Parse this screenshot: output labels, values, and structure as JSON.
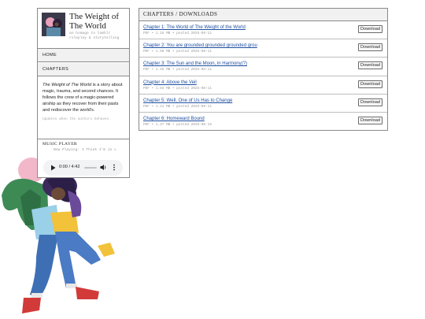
{
  "site": {
    "title": "The Weight of The World",
    "tagline": "an homage to tumblr roleplay & storytelling"
  },
  "nav": {
    "items": [
      {
        "label": "HOME"
      },
      {
        "label": "CHAPTERS"
      }
    ]
  },
  "about": {
    "title_italic": "The Weight of The World",
    "text_rest": " is a story about magic, trauma, and second chances. It follows the crew of a magic-powered airship as they recover from their pasts and rediscover the world's.",
    "updates": "Updates when the authors behaves."
  },
  "music": {
    "title": "MUSIC PLAYER",
    "now_playing": "Now Playing: I Think I'm in L",
    "time": "0:00 / 4:42",
    "progress": 0
  },
  "downloads": {
    "header": "CHAPTERS / DOWNLOADS",
    "button_label": "Download",
    "chapters": [
      {
        "title": "Chapter 1: The World of The Weight of the World",
        "meta": "PDF • 1.18 MB • posted 2025-08-11"
      },
      {
        "title": "Chapter 2: You are grounded grounded grounded grou",
        "meta": "PDF • 1.98 MB • posted 2025-08-11"
      },
      {
        "title": "Chapter 3: The Sun and the Moon, in Harmony(?)",
        "meta": "PDF • 1.45 MB • posted 2025-08-11"
      },
      {
        "title": "Chapter 4: Above the Veil",
        "meta": "PDF • 1.83 MB • posted 2025-08-11"
      },
      {
        "title": "Chapter 5: Well, One of Us Has to Change",
        "meta": "PDF • 1.21 MB • posted 2025-08-11"
      },
      {
        "title": "Chapter 6: Homeward Bound",
        "meta": "PDF • 1.37 MB • posted 2025-08-15"
      }
    ]
  },
  "icons": {
    "play": "play-icon",
    "volume": "volume-icon",
    "more": "more-vertical-icon"
  },
  "colors": {
    "link": "#1f4fa0",
    "border": "#8a8a8a",
    "header_bg": "#f1f1f1"
  }
}
